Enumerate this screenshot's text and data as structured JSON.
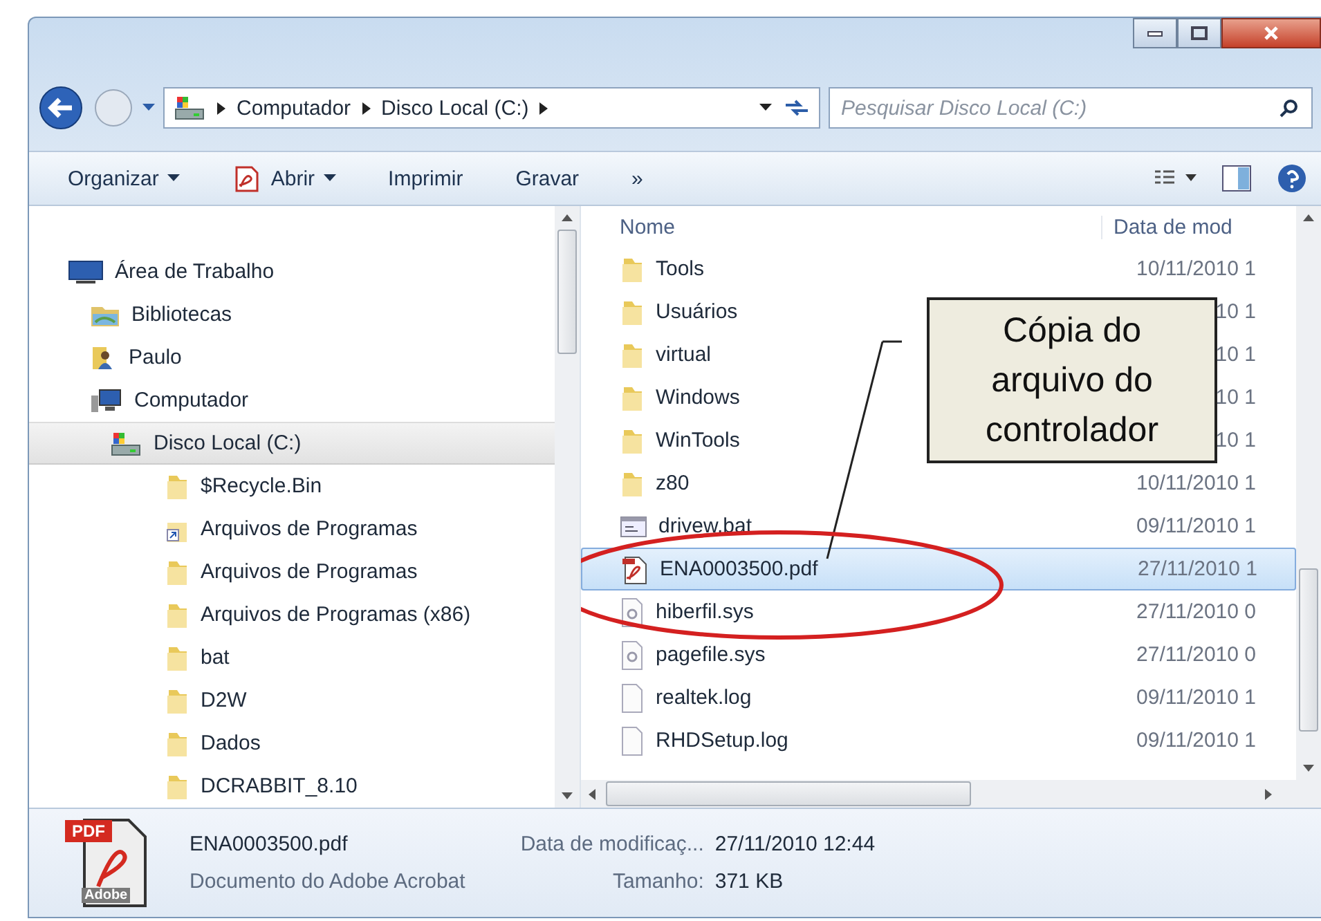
{
  "address": {
    "crumbs": [
      "Computador",
      "Disco Local (C:)"
    ]
  },
  "search": {
    "placeholder": "Pesquisar Disco Local (C:)"
  },
  "toolbar": [
    {
      "label": "Organizar",
      "kind": "menu"
    },
    {
      "label": "Abrir",
      "kind": "pdf-menu"
    },
    {
      "label": "Imprimir",
      "kind": "plain"
    },
    {
      "label": "Gravar",
      "kind": "plain"
    },
    {
      "label": "»",
      "kind": "plain"
    }
  ],
  "sidebar": {
    "items": [
      {
        "label": "Área de Trabalho",
        "kind": "desktop",
        "selected": false,
        "children": [
          {
            "label": "Bibliotecas",
            "kind": "library",
            "selected": false
          },
          {
            "label": "Paulo",
            "kind": "user",
            "selected": false
          },
          {
            "label": "Computador",
            "kind": "computer",
            "selected": false,
            "children": [
              {
                "label": "Disco Local (C:)",
                "kind": "drive",
                "selected": true,
                "children": [
                  {
                    "label": "$Recycle.Bin",
                    "kind": "folder",
                    "selected": false
                  },
                  {
                    "label": "Arquivos de Programas",
                    "kind": "shortcut",
                    "selected": false
                  },
                  {
                    "label": "Arquivos de Programas",
                    "kind": "folder",
                    "selected": false
                  },
                  {
                    "label": "Arquivos de Programas (x86)",
                    "kind": "folder",
                    "selected": false
                  },
                  {
                    "label": "bat",
                    "kind": "folder",
                    "selected": false
                  },
                  {
                    "label": "D2W",
                    "kind": "folder",
                    "selected": false
                  },
                  {
                    "label": "Dados",
                    "kind": "folder",
                    "selected": false
                  },
                  {
                    "label": "DCRABBIT_8.10",
                    "kind": "folder",
                    "selected": false
                  }
                ]
              }
            ]
          }
        ]
      }
    ]
  },
  "columns": [
    "Nome",
    "Data de mod"
  ],
  "files": [
    {
      "name": "Tools",
      "kind": "folder",
      "date": "10/11/2010 1",
      "selected": false
    },
    {
      "name": "Usuários",
      "kind": "folder",
      "date": "10 1",
      "selected": false
    },
    {
      "name": "virtual",
      "kind": "folder",
      "date": "10 1",
      "selected": false
    },
    {
      "name": "Windows",
      "kind": "folder",
      "date": "10 1",
      "selected": false
    },
    {
      "name": "WinTools",
      "kind": "folder",
      "date": "10 1",
      "selected": false
    },
    {
      "name": "z80",
      "kind": "folder",
      "date": "10/11/2010 1",
      "selected": false
    },
    {
      "name": "drivew.bat",
      "kind": "batch",
      "date": "09/11/2010 1",
      "selected": false
    },
    {
      "name": "ENA0003500.pdf",
      "kind": "pdf",
      "date": "27/11/2010 1",
      "selected": true
    },
    {
      "name": "hiberfil.sys",
      "kind": "system",
      "date": "27/11/2010 0",
      "selected": false
    },
    {
      "name": "pagefile.sys",
      "kind": "system",
      "date": "27/11/2010 0",
      "selected": false
    },
    {
      "name": "realtek.log",
      "kind": "text",
      "date": "09/11/2010 1",
      "selected": false
    },
    {
      "name": "RHDSetup.log",
      "kind": "text",
      "date": "09/11/2010 1",
      "selected": false
    }
  ],
  "callout": {
    "text": "Cópia do arquivo do controlador"
  },
  "details": {
    "icon_badge": "PDF",
    "icon_caption": "Adobe",
    "name": "ENA0003500.pdf",
    "type": "Documento do Adobe Acrobat",
    "fields": [
      {
        "label": "Data de modificaç...",
        "value": "27/11/2010 12:44"
      },
      {
        "label": "Tamanho:",
        "value": "371 KB"
      }
    ]
  }
}
